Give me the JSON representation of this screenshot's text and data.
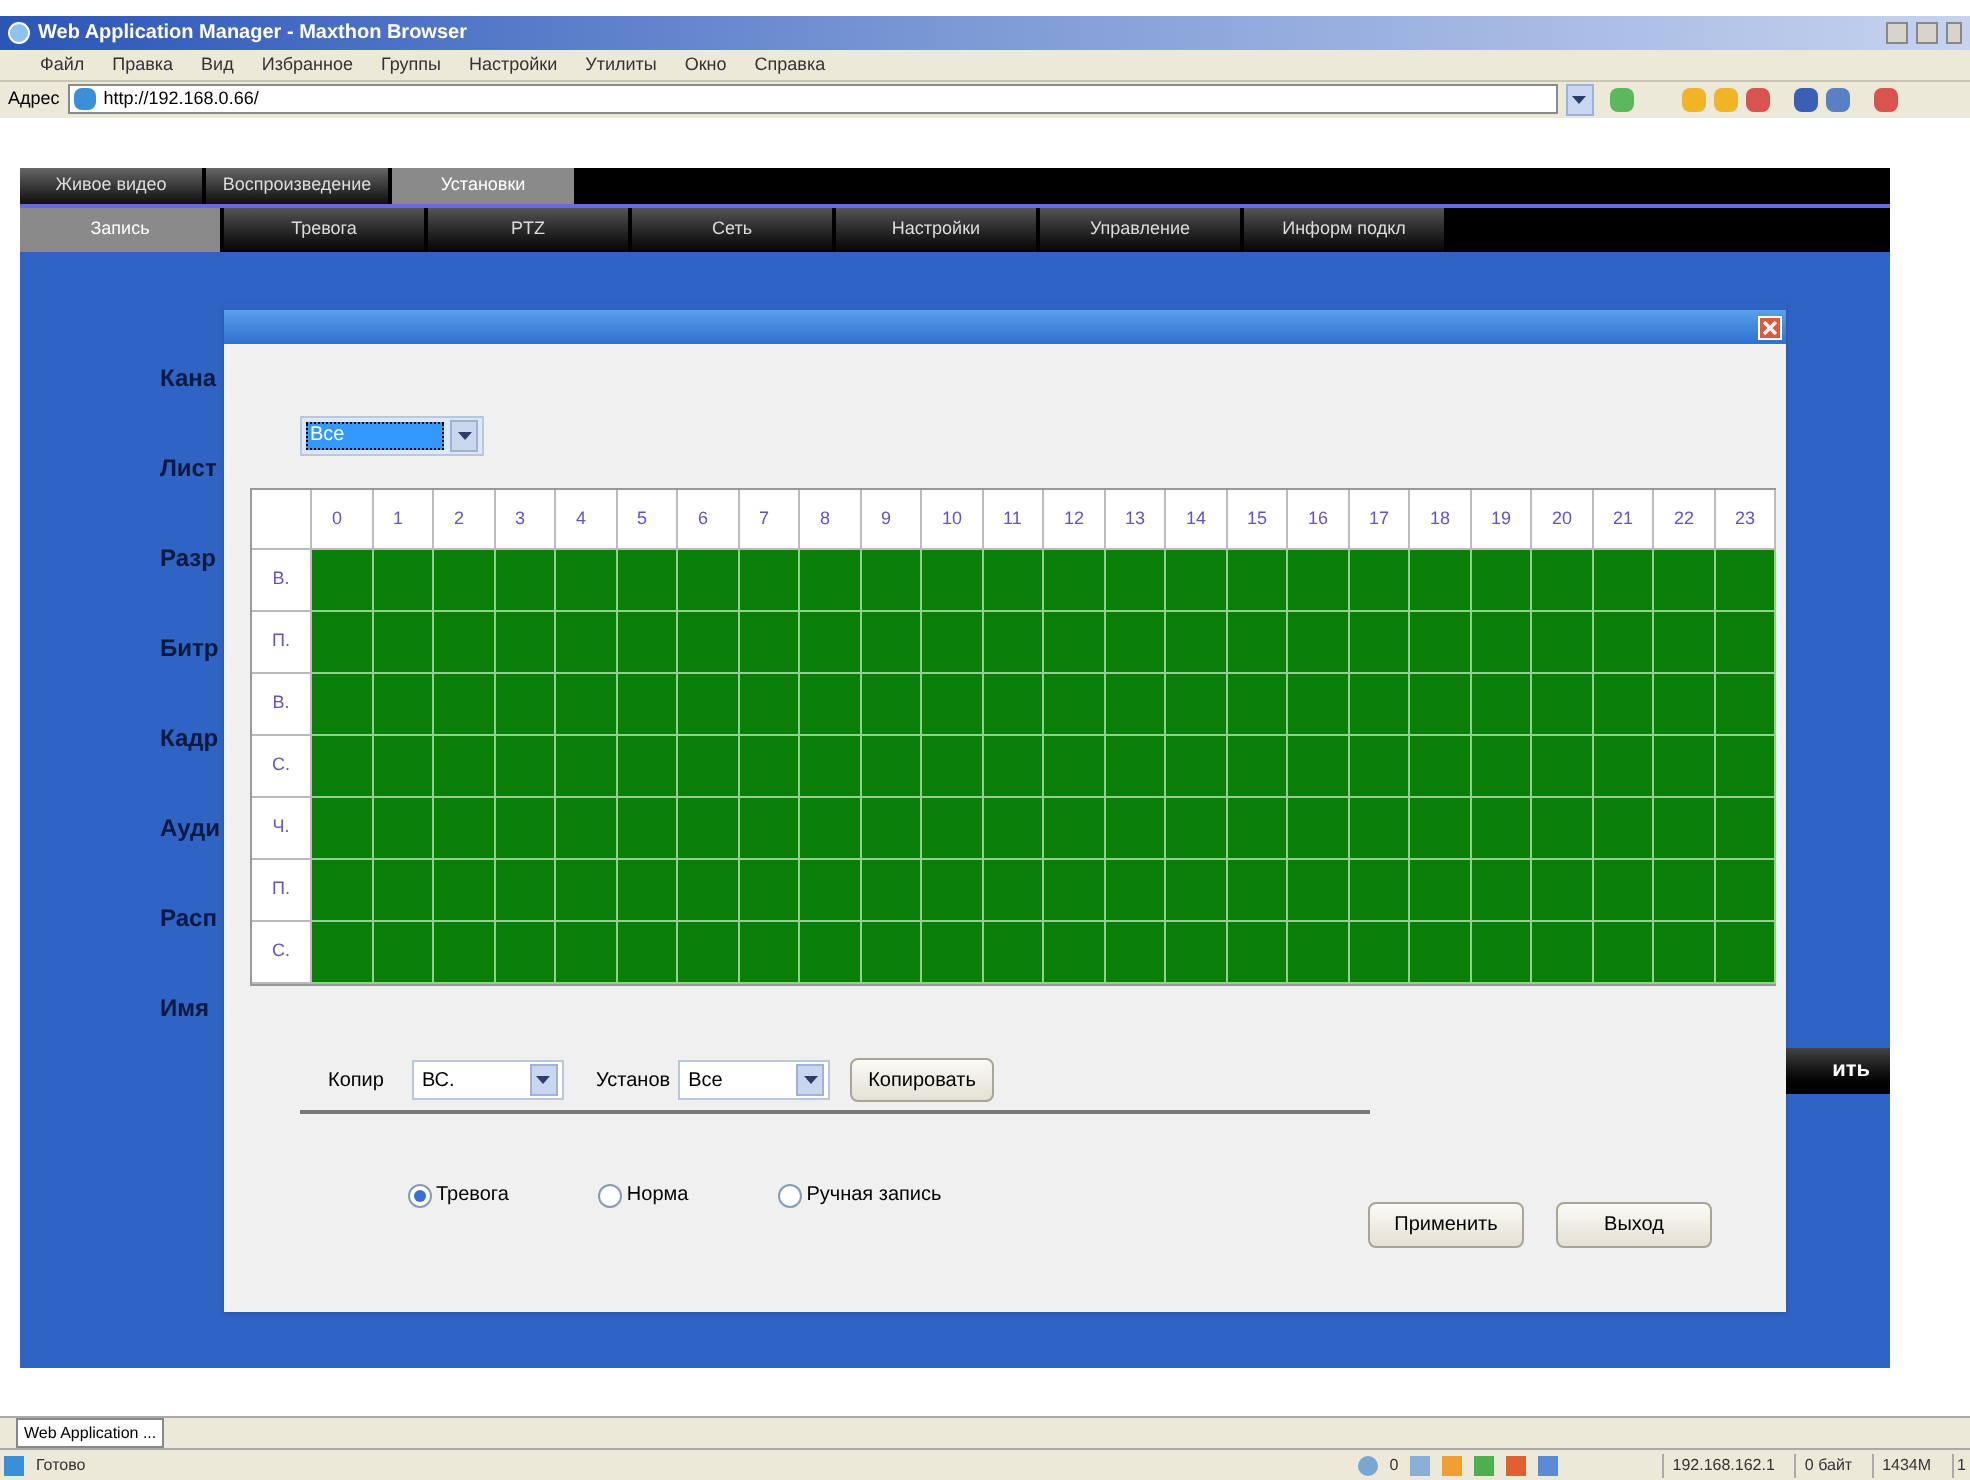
{
  "window": {
    "title": "Web Application Manager - Maxthon Browser"
  },
  "menu": [
    "Файл",
    "Правка",
    "Вид",
    "Избранное",
    "Группы",
    "Настройки",
    "Утилиты",
    "Окно",
    "Справка"
  ],
  "address": {
    "label": "Адрес",
    "value": "http://192.168.0.66/"
  },
  "tabs": [
    {
      "label": "Живое видео",
      "selected": false
    },
    {
      "label": "Воспроизведение",
      "selected": false
    },
    {
      "label": "Установки",
      "selected": true
    }
  ],
  "subtabs": [
    {
      "label": "Запись",
      "selected": true
    },
    {
      "label": "Тревога",
      "selected": false
    },
    {
      "label": "PTZ",
      "selected": false
    },
    {
      "label": "Сеть",
      "selected": false
    },
    {
      "label": "Настройки",
      "selected": false
    },
    {
      "label": "Управление",
      "selected": false
    },
    {
      "label": "Информ подкл",
      "selected": false
    }
  ],
  "background_labels": [
    "Кана",
    "Лист",
    "Разр",
    "Битр",
    "Кадр",
    "Ауди",
    "Расп",
    "Имя"
  ],
  "background_button": "ить",
  "dialog": {
    "day_select": "Все",
    "hours": [
      "0",
      "1",
      "2",
      "3",
      "4",
      "5",
      "6",
      "7",
      "8",
      "9",
      "10",
      "11",
      "12",
      "13",
      "14",
      "15",
      "16",
      "17",
      "18",
      "19",
      "20",
      "21",
      "22",
      "23"
    ],
    "rows": [
      {
        "day": "В.",
        "scheduled": true
      },
      {
        "day": "П.",
        "scheduled": true
      },
      {
        "day": "В.",
        "scheduled": true
      },
      {
        "day": "С.",
        "scheduled": true
      },
      {
        "day": "Ч.",
        "scheduled": true
      },
      {
        "day": "П.",
        "scheduled": true
      },
      {
        "day": "С.",
        "scheduled": true
      }
    ],
    "copy_label": "Копир",
    "copy_from": "ВС.",
    "set_label": "Установ",
    "copy_to": "Все",
    "copy_button": "Копировать",
    "modes": [
      {
        "label": "Тревога",
        "selected": true
      },
      {
        "label": "Норма",
        "selected": false
      },
      {
        "label": "Ручная запись",
        "selected": false
      }
    ],
    "apply_button": "Применить",
    "exit_button": "Выход"
  },
  "taskbar": [
    "Web Application ..."
  ],
  "status_bar": {
    "text": "Готово",
    "count": "0",
    "ip": "192.168.162.1",
    "traffic": "0 байт",
    "memory": "1434M",
    "extra": "1"
  }
}
